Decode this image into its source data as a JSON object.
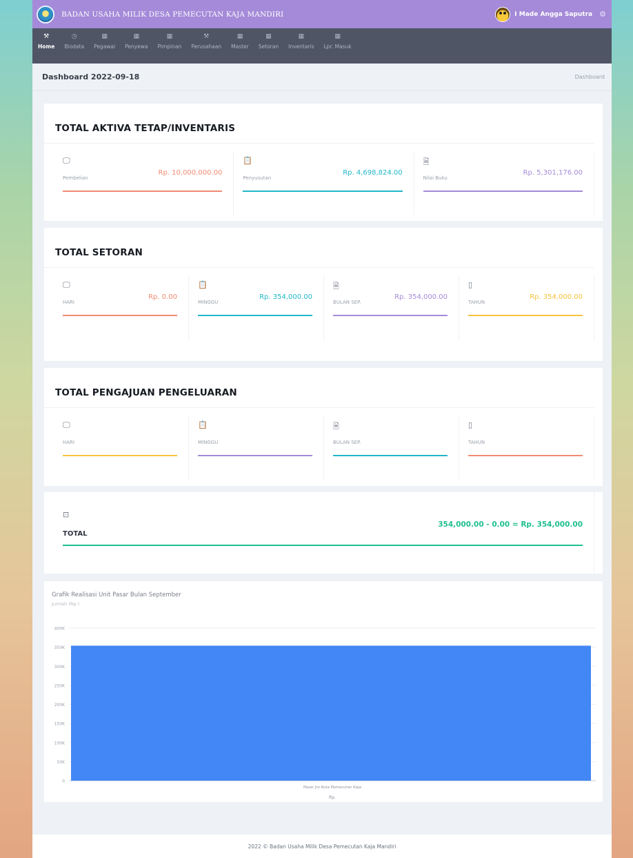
{
  "header": {
    "brand": "BADAN USAHA MILIK DESA PEMECUTAN KAJA MANDIRI",
    "user": "I Made Angga Saputra"
  },
  "nav": [
    {
      "label": "Home",
      "icon": "wrench-icon",
      "glyph": "⚒",
      "active": true
    },
    {
      "label": "Biodata",
      "icon": "clock-icon",
      "glyph": "◷",
      "active": false
    },
    {
      "label": "Pegawai",
      "icon": "calendar-icon",
      "glyph": "▦",
      "active": false
    },
    {
      "label": "Penyewa",
      "icon": "calendar-icon",
      "glyph": "▦",
      "active": false
    },
    {
      "label": "Pimpinan",
      "icon": "calendar-icon",
      "glyph": "▦",
      "active": false
    },
    {
      "label": "Perusahaan",
      "icon": "wrench-icon",
      "glyph": "⚒",
      "active": false
    },
    {
      "label": "Master",
      "icon": "calendar-icon",
      "glyph": "▦",
      "active": false
    },
    {
      "label": "Setoran",
      "icon": "calendar-icon",
      "glyph": "▦",
      "active": false
    },
    {
      "label": "Inventaris",
      "icon": "calendar-icon",
      "glyph": "▦",
      "active": false
    },
    {
      "label": "Lpr. Masuk",
      "icon": "calendar-icon",
      "glyph": "▦",
      "active": false
    }
  ],
  "page": {
    "title": "Dashboard 2022-09-18",
    "breadcrumb": "Dashboard"
  },
  "aktiva": {
    "title": "TOTAL AKTIVA TETAP/INVENTARIS",
    "items": [
      {
        "label": "Pembelian",
        "value": "Rp. 10,000,000.00",
        "color": "#f08b72",
        "icon": "monitor-icon"
      },
      {
        "label": "Penyusutan",
        "value": "Rp. 4,698,824.00",
        "color": "#22b7c8",
        "icon": "clipboard-icon"
      },
      {
        "label": "Nilai Buku",
        "value": "Rp. 5,301,176.00",
        "color": "#a48ad8",
        "icon": "document-icon"
      }
    ]
  },
  "setoran": {
    "title": "TOTAL SETORAN",
    "items": [
      {
        "label": "HARI",
        "value": "Rp. 0.00",
        "color": "#f08b72",
        "icon": "monitor-icon"
      },
      {
        "label": "MINGGU",
        "value": "Rp. 354,000.00",
        "color": "#22b7c8",
        "icon": "clipboard-icon"
      },
      {
        "label": "BULAN SEP.",
        "value": "Rp. 354,000.00",
        "color": "#a48ad8",
        "icon": "document-icon"
      },
      {
        "label": "TAHUN",
        "value": "Rp. 354,000.00",
        "color": "#f6c23e",
        "icon": "phone-icon"
      }
    ]
  },
  "pengajuan": {
    "title": "TOTAL PENGAJUAN PENGELUARAN",
    "items": [
      {
        "label": "HARI",
        "value": "",
        "color": "#f6c23e",
        "icon": "monitor-icon"
      },
      {
        "label": "MINGGU",
        "value": "",
        "color": "#a48ad8",
        "icon": "clipboard-icon"
      },
      {
        "label": "BULAN SEP.",
        "value": "",
        "color": "#22b7c8",
        "icon": "document-icon"
      },
      {
        "label": "TAHUN",
        "value": "",
        "color": "#f08b72",
        "icon": "phone-icon"
      }
    ]
  },
  "total": {
    "label": "TOTAL",
    "value": "354,000.00 - 0.00 = Rp. 354,000.00",
    "color": "#1fbf8f",
    "icon": "monitor-download-icon"
  },
  "chart_data": {
    "type": "bar",
    "title": "Grafik Realisasi Unit Pasar Bulan September",
    "subtitle": "Jumlah (Rp.)",
    "categories": [
      "Pasar Jro Kuta Pemecutan Kaja"
    ],
    "series": [
      {
        "name": "Rp.",
        "values": [
          354000
        ],
        "color": "#4287f5"
      }
    ],
    "xlabel": "Rp.",
    "ylim": [
      0,
      400000
    ],
    "yticks": [
      0,
      50000,
      100000,
      150000,
      200000,
      250000,
      300000,
      350000,
      400000
    ],
    "ytick_labels": [
      "0",
      "50K",
      "100K",
      "150K",
      "200K",
      "250K",
      "300K",
      "350K",
      "400K"
    ],
    "grid": true
  },
  "footer": {
    "text": "2022 © Badan Usaha Milik Desa Pemecutan Kaja Mandiri"
  }
}
